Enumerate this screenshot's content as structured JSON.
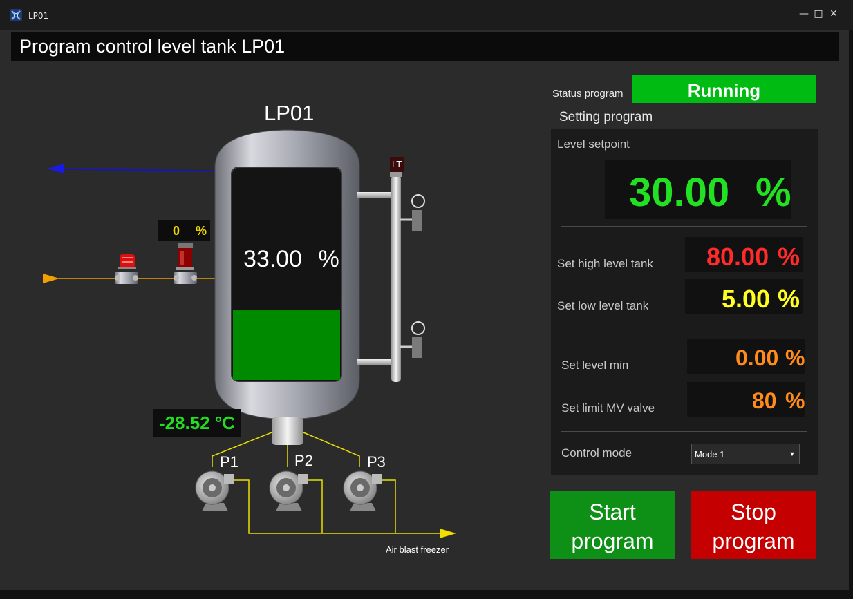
{
  "window": {
    "title": "LP01",
    "minimize_glyph": "—",
    "maximize_glyph": "□",
    "close_glyph": "✕"
  },
  "header": {
    "title": "Program control level tank LP01"
  },
  "process": {
    "tank_label": "LP01",
    "tank_level_value": "33.00",
    "tank_level_unit": "%",
    "tank_level_fraction": 0.33,
    "transmitter_tag": "LT",
    "valve_opening_value": "0",
    "valve_opening_unit": "%",
    "temperature": "-28.52 °C",
    "pumps": [
      "P1",
      "P2",
      "P3"
    ],
    "destination": "Air blast freezer"
  },
  "status": {
    "label": "Status program",
    "value": "Running",
    "color": "#00bb11"
  },
  "settings": {
    "title": "Setting program",
    "level_setpoint_label": "Level setpoint",
    "level_setpoint_value": "30.00",
    "level_setpoint_unit": "%",
    "high_level_label": "Set high level tank",
    "high_level_value": "80.00",
    "high_level_unit": "%",
    "low_level_label": "Set low level tank",
    "low_level_value": "5.00",
    "low_level_unit": "%",
    "level_min_label": "Set level min",
    "level_min_value": "0.00",
    "level_min_unit": "%",
    "limit_mv_label": "Set limit MV valve",
    "limit_mv_value": "80",
    "limit_mv_unit": "%",
    "control_mode_label": "Control mode",
    "control_mode_value": "Mode 1"
  },
  "buttons": {
    "start_line1": "Start",
    "start_line2": "program",
    "stop_line1": "Stop",
    "stop_line2": "program"
  },
  "colors": {
    "liquid": "#008a00",
    "start": "#0e8f16",
    "stop": "#c40000",
    "setpoint": "#22e022",
    "high": "#ff2a2a",
    "low": "#ffff22",
    "min_mv": "#ff8c1a",
    "outlet_line": "#1010e0",
    "inlet_line": "#f0a000",
    "pump_line": "#e8e000"
  },
  "icons": [
    "app-logo-icon",
    "signal-light-icon",
    "control-valve-icon",
    "level-switch-icon",
    "pump-icon",
    "arrow-icon",
    "dropdown-chevron-icon"
  ]
}
